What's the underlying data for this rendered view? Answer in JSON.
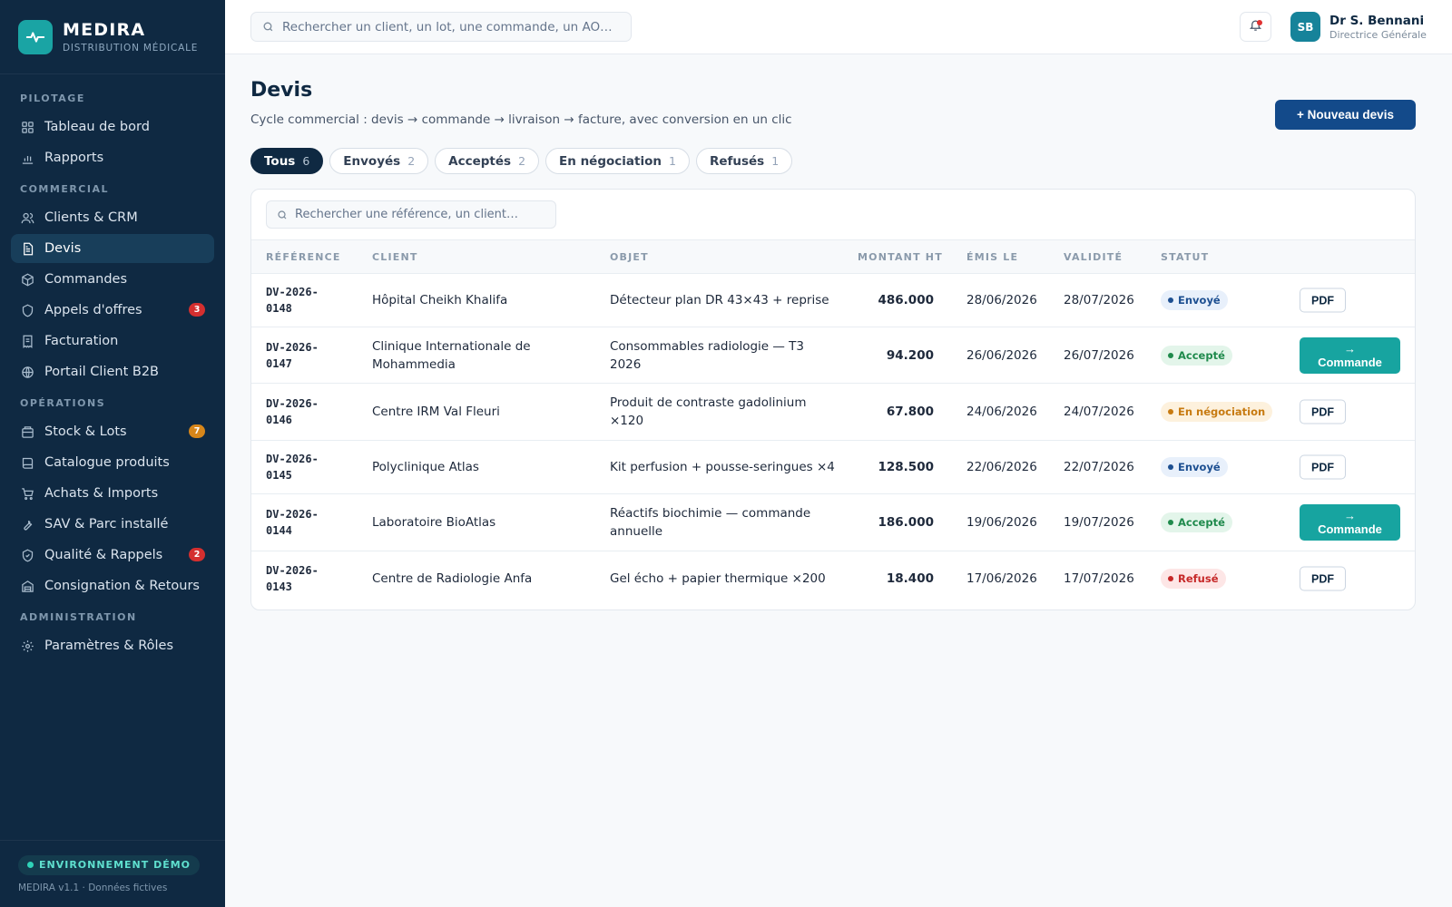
{
  "brand": {
    "name": "MEDIRA",
    "subtitle": "DISTRIBUTION MÉDICALE",
    "logo_icon": "pulse-icon"
  },
  "sidebar": {
    "sections": [
      {
        "title": "PILOTAGE",
        "items": [
          {
            "label": "Tableau de bord",
            "icon": "grid-icon"
          },
          {
            "label": "Rapports",
            "icon": "bar-chart-icon"
          }
        ]
      },
      {
        "title": "COMMERCIAL",
        "items": [
          {
            "label": "Clients & CRM",
            "icon": "users-icon"
          },
          {
            "label": "Devis",
            "icon": "document-icon",
            "active": true
          },
          {
            "label": "Commandes",
            "icon": "box-icon"
          },
          {
            "label": "Appels d'offres",
            "icon": "shield-icon",
            "badge": "3"
          },
          {
            "label": "Facturation",
            "icon": "receipt-icon"
          },
          {
            "label": "Portail Client B2B",
            "icon": "globe-icon"
          }
        ]
      },
      {
        "title": "OPÉRATIONS",
        "items": [
          {
            "label": "Stock & Lots",
            "icon": "stack-icon",
            "badge": "7"
          },
          {
            "label": "Catalogue produits",
            "icon": "book-icon"
          },
          {
            "label": "Achats & Imports",
            "icon": "cart-icon"
          },
          {
            "label": "SAV & Parc installé",
            "icon": "wrench-icon"
          },
          {
            "label": "Qualité & Rappels",
            "icon": "shield-check-icon",
            "badge": "2"
          },
          {
            "label": "Consignation & Retours",
            "icon": "warehouse-icon"
          }
        ]
      },
      {
        "title": "ADMINISTRATION",
        "items": [
          {
            "label": "Paramètres & Rôles",
            "icon": "gear-icon"
          }
        ]
      }
    ],
    "footer": {
      "env_label": "ENVIRONNEMENT DÉMO",
      "meta": "MEDIRA v1.1 · Données fictives"
    }
  },
  "topbar": {
    "search_placeholder": "Rechercher un client, un lot, une commande, un AO…",
    "user": {
      "initials": "SB",
      "name": "Dr S. Bennani",
      "role": "Directrice Générale"
    }
  },
  "page": {
    "title": "Devis",
    "subtitle": "Cycle commercial : devis → commande → livraison → facture, avec conversion en un clic",
    "new_button": "+ Nouveau devis",
    "tabs": [
      {
        "label": "Tous",
        "count": "6",
        "active": true
      },
      {
        "label": "Envoyés",
        "count": "2"
      },
      {
        "label": "Acceptés",
        "count": "2"
      },
      {
        "label": "En négociation",
        "count": "1"
      },
      {
        "label": "Refusés",
        "count": "1"
      }
    ],
    "table_search_placeholder": "Rechercher une référence, un client…",
    "columns": [
      "RÉFÉRENCE",
      "CLIENT",
      "OBJET",
      "MONTANT HT",
      "ÉMIS LE",
      "VALIDITÉ",
      "STATUT"
    ],
    "rows": [
      {
        "ref": "DV-2026-0148",
        "client": "Hôpital Cheikh Khalifa",
        "objet": "Détecteur plan DR 43×43 + reprise",
        "montant": "486.000",
        "emis": "28/06/2026",
        "validite": "28/07/2026",
        "statut": "Envoyé",
        "action": "PDF"
      },
      {
        "ref": "DV-2026-0147",
        "client": "Clinique Internationale de Mohammedia",
        "objet": "Consommables radiologie — T3 2026",
        "montant": "94.200",
        "emis": "26/06/2026",
        "validite": "26/07/2026",
        "statut": "Accepté",
        "action": "→ Commande"
      },
      {
        "ref": "DV-2026-0146",
        "client": "Centre IRM Val Fleuri",
        "objet": "Produit de contraste gadolinium ×120",
        "montant": "67.800",
        "emis": "24/06/2026",
        "validite": "24/07/2026",
        "statut": "En négociation",
        "action": "PDF"
      },
      {
        "ref": "DV-2026-0145",
        "client": "Polyclinique Atlas",
        "objet": "Kit perfusion + pousse-seringues ×4",
        "montant": "128.500",
        "emis": "22/06/2026",
        "validite": "22/07/2026",
        "statut": "Envoyé",
        "action": "PDF"
      },
      {
        "ref": "DV-2026-0144",
        "client": "Laboratoire BioAtlas",
        "objet": "Réactifs biochimie — commande annuelle",
        "montant": "186.000",
        "emis": "19/06/2026",
        "validite": "19/07/2026",
        "statut": "Accepté",
        "action": "→ Commande"
      },
      {
        "ref": "DV-2026-0143",
        "client": "Centre de Radiologie Anfa",
        "objet": "Gel écho + papier thermique ×200",
        "montant": "18.400",
        "emis": "17/06/2026",
        "validite": "17/07/2026",
        "statut": "Refusé",
        "action": "PDF"
      }
    ],
    "status_colors": {
      "Envoyé": {
        "bg": "#e8f0fb",
        "fg": "#1d4f91"
      },
      "Accepté": {
        "bg": "#e3f5ea",
        "fg": "#1f8a4c"
      },
      "En négociation": {
        "bg": "#fdf1dd",
        "fg": "#c77a10"
      },
      "Refusé": {
        "bg": "#fde6e6",
        "fg": "#c62828"
      }
    }
  }
}
